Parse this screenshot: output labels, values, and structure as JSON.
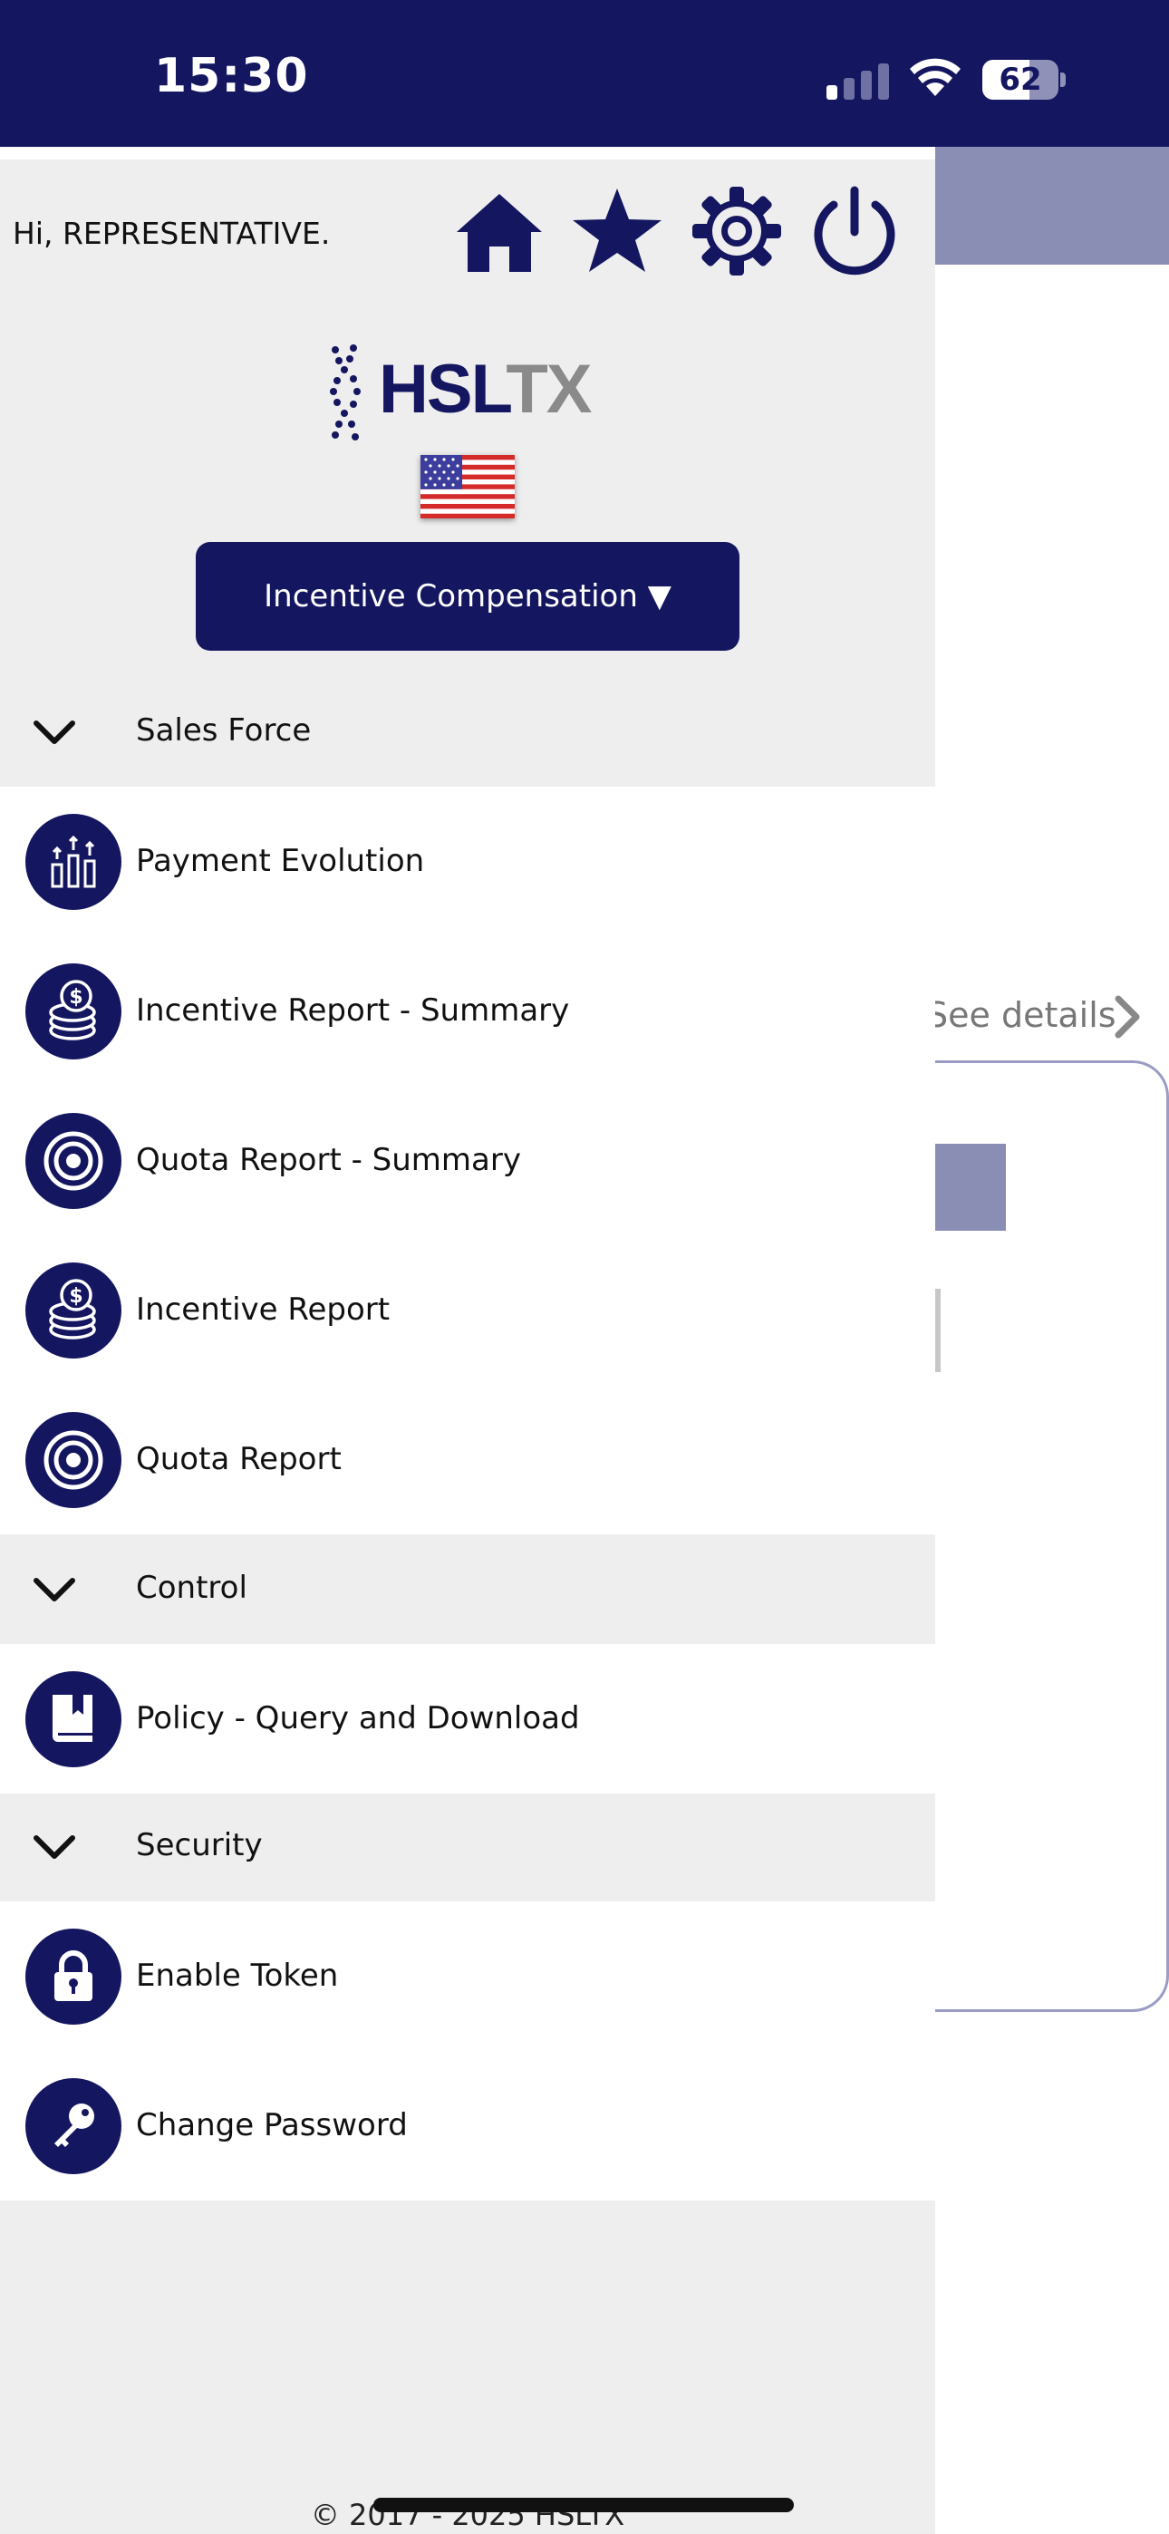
{
  "status_bar": {
    "time": "15:30",
    "battery": "62",
    "battery_level": 0.62
  },
  "drawer": {
    "greeting": "Hi, REPRESENTATIVE.",
    "top_icons": [
      "home-icon",
      "star-icon",
      "gear-icon",
      "power-icon"
    ],
    "logo": {
      "part1": "HSL",
      "part2": "TX"
    },
    "module_selector": "Incentive Compensation ▼",
    "sections": [
      {
        "label": "Sales Force",
        "items": [
          {
            "label": "Payment Evolution",
            "icon": "bar-chart-icon"
          },
          {
            "label": "Incentive Report - Summary",
            "icon": "coins-icon"
          },
          {
            "label": "Quota Report - Summary",
            "icon": "target-icon"
          },
          {
            "label": "Incentive Report",
            "icon": "coins-icon"
          },
          {
            "label": "Quota Report",
            "icon": "target-icon"
          }
        ]
      },
      {
        "label": "Control",
        "items": [
          {
            "label": "Policy - Query and Download",
            "icon": "book-icon"
          }
        ]
      },
      {
        "label": "Security",
        "items": [
          {
            "label": "Enable Token",
            "icon": "lock-icon"
          },
          {
            "label": "Change Password",
            "icon": "key-icon"
          }
        ]
      }
    ],
    "footer": "© 2017 - 2025 HSLTX"
  },
  "background": {
    "see_details": "See details"
  },
  "colors": {
    "primary": "#141660",
    "drawer_bg": "#eeeeee",
    "accent_band": "#8a8db4"
  }
}
